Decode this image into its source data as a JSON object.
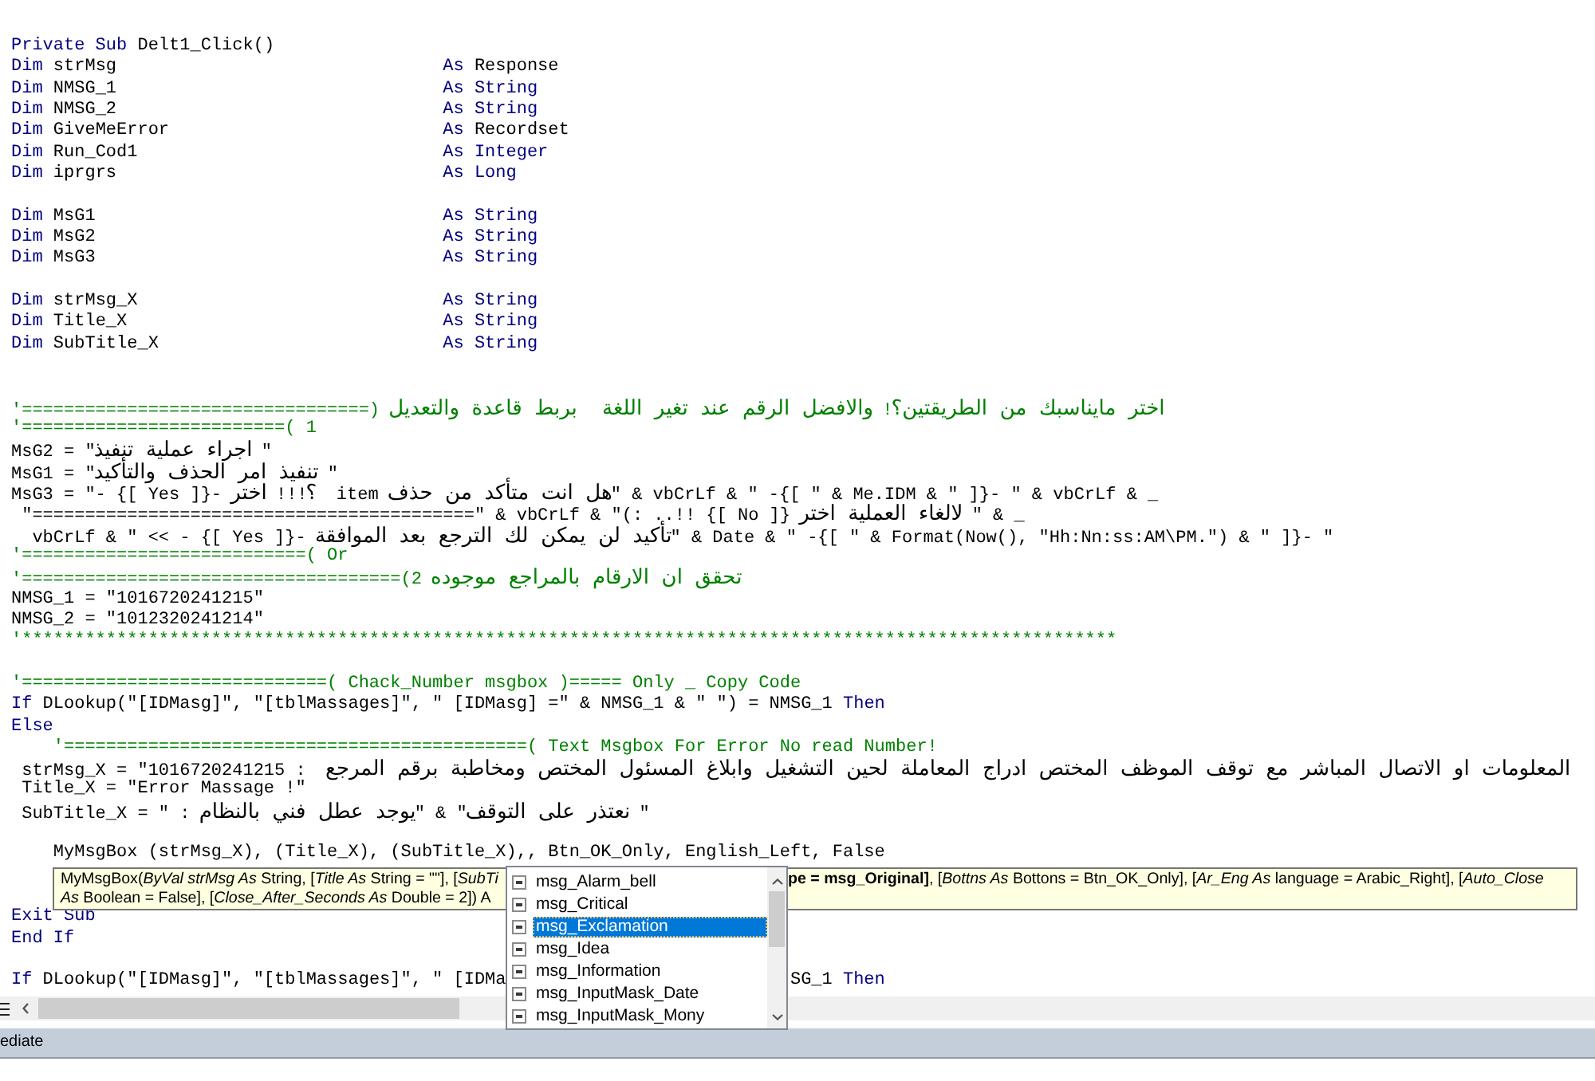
{
  "code_lines": [
    {
      "kind": "code",
      "tokens": [
        {
          "kind": "keyword",
          "text": "Private Sub"
        },
        {
          "kind": "plain",
          "text": " Delt1_Click()"
        }
      ]
    },
    {
      "kind": "declaration",
      "left": [
        {
          "kind": "keyword",
          "text": "Dim"
        },
        {
          "kind": "plain",
          "text": " strMsg"
        }
      ],
      "right": [
        {
          "kind": "keyword",
          "text": "As"
        },
        {
          "kind": "plain",
          "text": " Response"
        }
      ]
    },
    {
      "kind": "declaration",
      "left": [
        {
          "kind": "keyword",
          "text": "Dim"
        },
        {
          "kind": "plain",
          "text": " NMSG_1"
        }
      ],
      "right": [
        {
          "kind": "keyword",
          "text": "As"
        },
        {
          "kind": "keyword",
          "text": " String"
        }
      ]
    },
    {
      "kind": "declaration",
      "left": [
        {
          "kind": "keyword",
          "text": "Dim"
        },
        {
          "kind": "plain",
          "text": " NMSG_2"
        }
      ],
      "right": [
        {
          "kind": "keyword",
          "text": "As"
        },
        {
          "kind": "keyword",
          "text": " String"
        }
      ]
    },
    {
      "kind": "declaration",
      "left": [
        {
          "kind": "keyword",
          "text": "Dim"
        },
        {
          "kind": "plain",
          "text": " GiveMeError"
        }
      ],
      "right": [
        {
          "kind": "keyword",
          "text": "As"
        },
        {
          "kind": "plain",
          "text": " Recordset"
        }
      ]
    },
    {
      "kind": "declaration",
      "left": [
        {
          "kind": "keyword",
          "text": "Dim"
        },
        {
          "kind": "plain",
          "text": " Run_Cod1"
        }
      ],
      "right": [
        {
          "kind": "keyword",
          "text": "As"
        },
        {
          "kind": "keyword",
          "text": " Integer"
        }
      ]
    },
    {
      "kind": "declaration",
      "left": [
        {
          "kind": "keyword",
          "text": "Dim"
        },
        {
          "kind": "plain",
          "text": " iprgrs"
        }
      ],
      "right": [
        {
          "kind": "keyword",
          "text": "As"
        },
        {
          "kind": "keyword",
          "text": " Long"
        }
      ]
    },
    {
      "kind": "blank"
    },
    {
      "kind": "declaration",
      "left": [
        {
          "kind": "keyword",
          "text": "Dim"
        },
        {
          "kind": "plain",
          "text": " MsG1"
        }
      ],
      "right": [
        {
          "kind": "keyword",
          "text": "As"
        },
        {
          "kind": "keyword",
          "text": " String"
        }
      ]
    },
    {
      "kind": "declaration",
      "left": [
        {
          "kind": "keyword",
          "text": "Dim"
        },
        {
          "kind": "plain",
          "text": " MsG2"
        }
      ],
      "right": [
        {
          "kind": "keyword",
          "text": "As"
        },
        {
          "kind": "keyword",
          "text": " String"
        }
      ]
    },
    {
      "kind": "declaration",
      "left": [
        {
          "kind": "keyword",
          "text": "Dim"
        },
        {
          "kind": "plain",
          "text": " MsG3"
        }
      ],
      "right": [
        {
          "kind": "keyword",
          "text": "As"
        },
        {
          "kind": "keyword",
          "text": " String"
        }
      ]
    },
    {
      "kind": "blank"
    },
    {
      "kind": "declaration",
      "left": [
        {
          "kind": "keyword",
          "text": "Dim"
        },
        {
          "kind": "plain",
          "text": " strMsg_X"
        }
      ],
      "right": [
        {
          "kind": "keyword",
          "text": "As"
        },
        {
          "kind": "keyword",
          "text": " String"
        }
      ]
    },
    {
      "kind": "declaration",
      "left": [
        {
          "kind": "keyword",
          "text": "Dim"
        },
        {
          "kind": "plain",
          "text": " Title_X"
        }
      ],
      "right": [
        {
          "kind": "keyword",
          "text": "As"
        },
        {
          "kind": "keyword",
          "text": " String"
        }
      ]
    },
    {
      "kind": "declaration",
      "left": [
        {
          "kind": "keyword",
          "text": "Dim"
        },
        {
          "kind": "plain",
          "text": " SubTitle_X"
        }
      ],
      "right": [
        {
          "kind": "keyword",
          "text": "As"
        },
        {
          "kind": "keyword",
          "text": " String"
        }
      ]
    },
    {
      "kind": "blank"
    },
    {
      "kind": "blank"
    },
    {
      "kind": "code",
      "tokens": [
        {
          "kind": "comment",
          "text": "'=================================) اختر مايناسبك من الطريقتين؟! والافضل الرقم عند تغير اللغة  بربط قاعدة والتعديل"
        }
      ]
    },
    {
      "kind": "code",
      "tokens": [
        {
          "kind": "comment",
          "text": "'=========================( 1"
        }
      ]
    },
    {
      "kind": "code",
      "tokens": [
        {
          "kind": "plain",
          "text": "MsG2 = \"اجراء عملية تنفيذ \""
        }
      ]
    },
    {
      "kind": "code",
      "tokens": [
        {
          "kind": "plain",
          "text": "MsG1 = \"تنفيذ امر الحذف والتأكيد \""
        }
      ]
    },
    {
      "kind": "code",
      "tokens": [
        {
          "kind": "plain",
          "text": "MsG3 = \"- {[ Yes ]}- ؟!!! اختر  item هل انت متأكد من حذف\" & vbCrLf & \" -{[ \" & Me.IDM & \" ]}- \" & vbCrLf & _"
        }
      ]
    },
    {
      "kind": "code",
      "tokens": [
        {
          "kind": "plain",
          "text": " \"==========================================\" & vbCrLf & \"(: ..!! {[ No ]} لالغاء العملية اختر \" & _"
        }
      ]
    },
    {
      "kind": "code",
      "tokens": [
        {
          "kind": "plain",
          "text": "  vbCrLf & \" << - {[ Yes ]}- تأكيد لن يمكن لك الترجع بعد الموافقة\" & Date & \" -{[ \" & Format(Now(), \"Hh:Nn:ss:AM\\PM.\") & \" ]}- \""
        }
      ]
    },
    {
      "kind": "code",
      "tokens": [
        {
          "kind": "comment",
          "text": "'===========================( Or"
        }
      ]
    },
    {
      "kind": "code",
      "tokens": [
        {
          "kind": "comment",
          "text": "'====================================(2 تحقق ان الارقام بالمراجع موجوده"
        }
      ]
    },
    {
      "kind": "code",
      "tokens": [
        {
          "kind": "plain",
          "text": "NMSG_1 = \"1016720241215\""
        }
      ]
    },
    {
      "kind": "code",
      "tokens": [
        {
          "kind": "plain",
          "text": "NMSG_2 = \"1012320241214\""
        }
      ]
    },
    {
      "kind": "code",
      "tokens": [
        {
          "kind": "comment",
          "text": "'********************************************************************************************************"
        }
      ]
    },
    {
      "kind": "blank"
    },
    {
      "kind": "code",
      "tokens": [
        {
          "kind": "comment",
          "text": "'=============================( Chack_Number msgbox )===== Only _ Copy Code"
        }
      ]
    },
    {
      "kind": "code",
      "tokens": [
        {
          "kind": "keyword",
          "text": "If"
        },
        {
          "kind": "plain",
          "text": " DLookup(\"[IDMasg]\", \"[tblMassages]\", \" [IDMasg] =\" & NMSG_1 & \" \") = NMSG_1 "
        },
        {
          "kind": "keyword",
          "text": "Then"
        }
      ]
    },
    {
      "kind": "code",
      "tokens": [
        {
          "kind": "keyword",
          "text": "Else"
        }
      ]
    },
    {
      "kind": "code",
      "tokens": [
        {
          "kind": "comment",
          "text": "    '============================================( Text Msgbox For Error No read Number!"
        }
      ]
    },
    {
      "kind": "code",
      "tokens": [
        {
          "kind": "plain",
          "text": " strMsg_X = \"1016720241215 :  المعلومات او الاتصال المباشر مع توقف الموظف المختص ادراج المعاملة لحين التشغيل وابلاغ المسئول المختص ومخاطبة برقم المرجع"
        }
      ]
    },
    {
      "kind": "code",
      "tokens": [
        {
          "kind": "plain",
          "text": " Title_X = \"Error Massage !\""
        }
      ]
    },
    {
      "kind": "code",
      "tokens": [
        {
          "kind": "plain",
          "text": " SubTitle_X = \" : نعتذر على التوقف\" & \"يوجد عطل فني بالنظام \""
        }
      ]
    },
    {
      "kind": "blank"
    },
    {
      "kind": "code",
      "tokens": [
        {
          "kind": "plain",
          "text": "    MyMsgBox (strMsg_X), (Title_X), (SubTitle_X),, Btn_OK_Only, English_Left, False"
        }
      ]
    },
    {
      "kind": "blank"
    },
    {
      "kind": "blank"
    },
    {
      "kind": "code",
      "tokens": [
        {
          "kind": "keyword",
          "text": "Exit Sub"
        }
      ]
    },
    {
      "kind": "code",
      "tokens": [
        {
          "kind": "keyword",
          "text": "End If"
        }
      ]
    },
    {
      "kind": "blank"
    },
    {
      "kind": "split",
      "left": [
        {
          "kind": "keyword",
          "text": "If"
        },
        {
          "kind": "plain",
          "text": " DLookup(\"[IDMasg]\", \"[tblMassages]\", \" [IDMa"
        }
      ],
      "right": [
        {
          "kind": "plain",
          "text": "SG_1 "
        },
        {
          "kind": "keyword",
          "text": "Then"
        }
      ]
    }
  ],
  "quick_info": {
    "lines": [
      {
        "left": "MyMsgBox(*ByVal strMsg As* String, [*Title As* String = \"\"], [*SubTi*",
        "right": "**pe = msg_Original]**, [*Bottns As* Bottons = Btn_OK_Only], [*Ar_Eng As* language = Arabic_Right], [*Auto_Close*"
      },
      {
        "left": "*As* Boolean = False], [*Close_After_Seconds As* Double = 2]) A"
      }
    ]
  },
  "completion_list": {
    "items": [
      {
        "label": "msg_Alarm_bell",
        "selected": false
      },
      {
        "label": "msg_Critical",
        "selected": false
      },
      {
        "label": "msg_Exclamation",
        "selected": true
      },
      {
        "label": "msg_Idea",
        "selected": false
      },
      {
        "label": "msg_Information",
        "selected": false
      },
      {
        "label": "msg_InputMask_Date",
        "selected": false
      },
      {
        "label": "msg_InputMask_Mony",
        "selected": false
      }
    ]
  },
  "immediate_window": {
    "title": "ediate"
  }
}
